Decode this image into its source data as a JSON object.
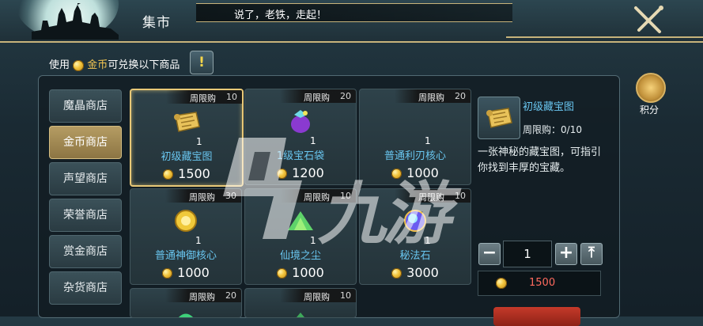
{
  "header": {
    "title": "集市",
    "ticker": "说了，老铁，走起！"
  },
  "info": {
    "prefix": "使用",
    "currency": "金币",
    "suffix": "可兑换以下商品",
    "alert": "!"
  },
  "score": {
    "label": "积分"
  },
  "sidebar": [
    {
      "label": "魔晶商店"
    },
    {
      "label": "金币商店"
    },
    {
      "label": "声望商店"
    },
    {
      "label": "荣誉商店"
    },
    {
      "label": "赏金商店"
    },
    {
      "label": "杂货商店"
    }
  ],
  "items": [
    {
      "tag": "周限购",
      "limit": "10",
      "qty": "1",
      "name": "初级藏宝图",
      "price": "1500",
      "icon": "treasure-map-icon"
    },
    {
      "tag": "周限购",
      "limit": "20",
      "qty": "1",
      "name": "1级宝石袋",
      "price": "1200",
      "icon": "gem-bag-icon"
    },
    {
      "tag": "周限购",
      "limit": "20",
      "qty": "1",
      "name": "普通利刃核心",
      "price": "1000",
      "icon": "blade-core-icon"
    },
    {
      "tag": "周限购",
      "limit": "30",
      "qty": "1",
      "name": "普通神御核心",
      "price": "1000",
      "icon": "guard-core-icon"
    },
    {
      "tag": "周限购",
      "limit": "10",
      "qty": "1",
      "name": "仙境之尘",
      "price": "1000",
      "icon": "fairy-dust-icon"
    },
    {
      "tag": "周限购",
      "limit": "10",
      "qty": "1",
      "name": "秘法石",
      "price": "3000",
      "icon": "arcane-stone-icon"
    },
    {
      "tag": "周限购",
      "limit": "20",
      "qty": "",
      "name": "",
      "price": "",
      "icon": "item-icon"
    },
    {
      "tag": "周限购",
      "limit": "10",
      "qty": "",
      "name": "",
      "price": "",
      "icon": "item-icon"
    }
  ],
  "detail": {
    "name": "初级藏宝图",
    "limit_label": "周限购：",
    "limit_value": "0/10",
    "description": "一张神秘的藏宝图，可指引你找到丰厚的宝藏。",
    "quantity": "1",
    "total": "1500"
  },
  "watermark": "九游",
  "colors": {
    "accent_gold": "#c7b37b",
    "item_name": "#69c6f0",
    "price_red": "#ff6a5e"
  }
}
